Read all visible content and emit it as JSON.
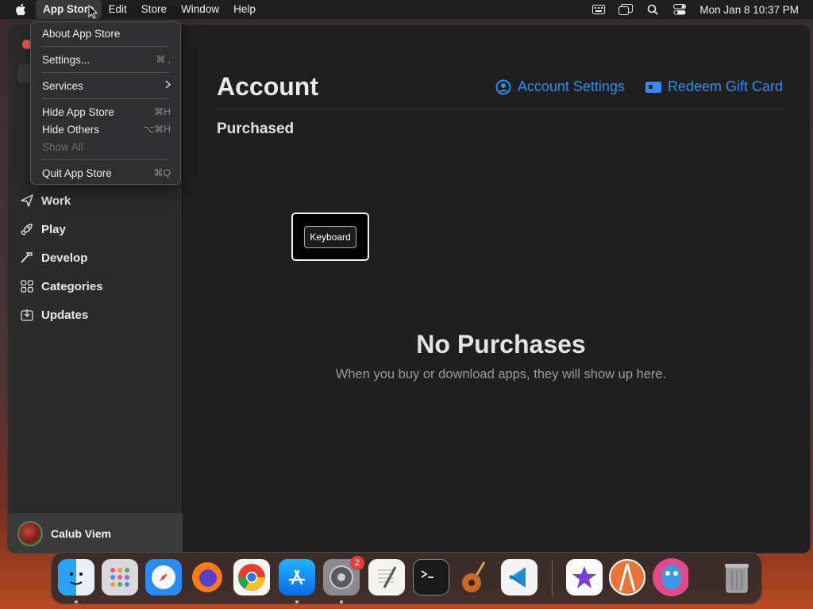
{
  "menubar": {
    "app_name": "App Store",
    "items": [
      "Edit",
      "Store",
      "Window",
      "Help"
    ],
    "clock": "Mon Jan 8  10:37 PM"
  },
  "app_menu": {
    "about": "About App Store",
    "settings": "Settings...",
    "settings_shortcut": "⌘ ,",
    "services": "Services",
    "hide": "Hide App Store",
    "hide_shortcut": "⌘H",
    "hide_others": "Hide Others",
    "hide_others_shortcut": "⌥⌘H",
    "show_all": "Show All",
    "quit": "Quit App Store",
    "quit_shortcut": "⌘Q"
  },
  "sidebar": {
    "items": [
      {
        "label": "Work",
        "icon": "paperplane-icon"
      },
      {
        "label": "Play",
        "icon": "rocket-icon"
      },
      {
        "label": "Develop",
        "icon": "hammer-icon"
      },
      {
        "label": "Categories",
        "icon": "grid-icon"
      },
      {
        "label": "Updates",
        "icon": "download-icon"
      }
    ],
    "user_name": "Calub Viem"
  },
  "main": {
    "title": "Account",
    "account_settings": "Account Settings",
    "redeem": "Redeem Gift Card",
    "section": "Purchased",
    "keyboard_label": "Keyboard",
    "empty_title": "No Purchases",
    "empty_subtitle": "When you buy or download apps, they will show up here."
  },
  "dock": {
    "apps": [
      "Finder",
      "Launchpad",
      "Safari",
      "Firefox",
      "Chrome",
      "App Store",
      "System Settings",
      "TextEdit",
      "Terminal",
      "GarageBand",
      "VS Code",
      "iMovie",
      "Instruments",
      "Cyberduck",
      "Trash"
    ],
    "settings_badge": "2"
  },
  "colors": {
    "accent": "#2f8cf3",
    "window_bg": "#1f1f1f",
    "sidebar_bg": "#2b2b2b"
  }
}
